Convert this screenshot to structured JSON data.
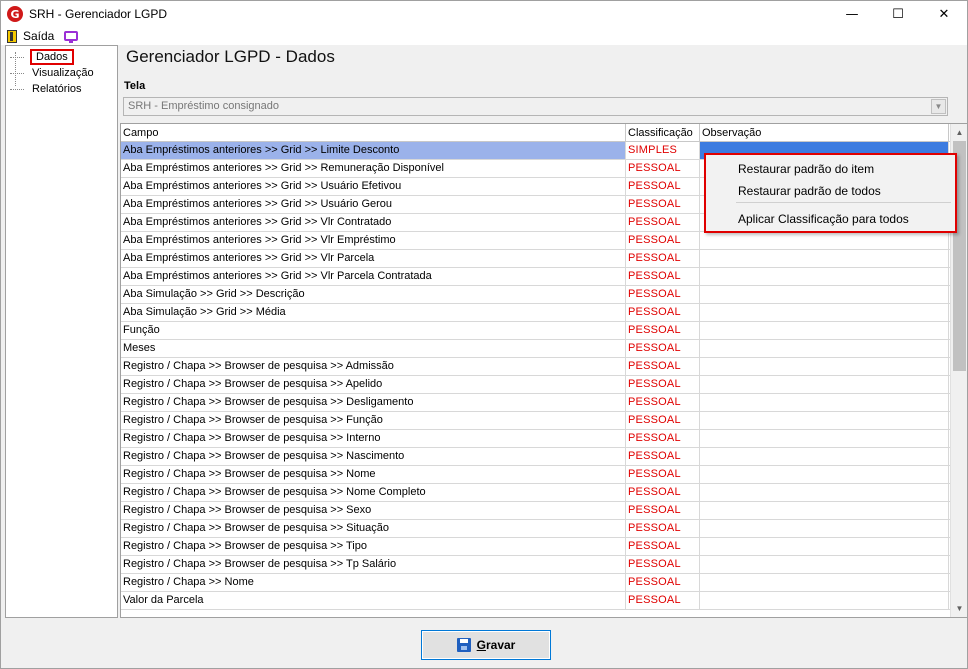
{
  "window": {
    "title": "SRH - Gerenciador LGPD",
    "app_icon_letter": "G",
    "controls": {
      "minimize": "—",
      "maximize": "☐",
      "close": "✕"
    }
  },
  "menubar": {
    "exit_label": "Saída"
  },
  "tree": {
    "items": [
      {
        "label": "Dados",
        "selected": true
      },
      {
        "label": "Visualização"
      },
      {
        "label": "Relatórios"
      }
    ]
  },
  "header": {
    "title": "Gerenciador LGPD - Dados"
  },
  "tela": {
    "label": "Tela",
    "value": "SRH - Empréstimo consignado"
  },
  "grid": {
    "columns": [
      "Campo",
      "Classificação",
      "Observação"
    ],
    "rows": [
      {
        "campo": "Aba Empréstimos anteriores >> Grid >> Limite Desconto",
        "classificacao": "SIMPLES",
        "observacao": ""
      },
      {
        "campo": "Aba Empréstimos anteriores >> Grid >> Remuneração Disponível",
        "classificacao": "PESSOAL",
        "observacao": ""
      },
      {
        "campo": "Aba Empréstimos anteriores >> Grid >> Usuário Efetivou",
        "classificacao": "PESSOAL",
        "observacao": ""
      },
      {
        "campo": "Aba Empréstimos anteriores >> Grid >> Usuário Gerou",
        "classificacao": "PESSOAL",
        "observacao": ""
      },
      {
        "campo": "Aba Empréstimos anteriores >> Grid >> Vlr Contratado",
        "classificacao": "PESSOAL",
        "observacao": ""
      },
      {
        "campo": "Aba Empréstimos anteriores >> Grid >> Vlr Empréstimo",
        "classificacao": "PESSOAL",
        "observacao": ""
      },
      {
        "campo": "Aba Empréstimos anteriores >> Grid >> Vlr Parcela",
        "classificacao": "PESSOAL",
        "observacao": ""
      },
      {
        "campo": "Aba Empréstimos anteriores >> Grid >> Vlr Parcela Contratada",
        "classificacao": "PESSOAL",
        "observacao": ""
      },
      {
        "campo": "Aba Simulação >> Grid >> Descrição",
        "classificacao": "PESSOAL",
        "observacao": ""
      },
      {
        "campo": "Aba Simulação >> Grid >> Média",
        "classificacao": "PESSOAL",
        "observacao": ""
      },
      {
        "campo": "Função",
        "classificacao": "PESSOAL",
        "observacao": ""
      },
      {
        "campo": "Meses",
        "classificacao": "PESSOAL",
        "observacao": ""
      },
      {
        "campo": "Registro / Chapa >> Browser de pesquisa >> Admissão",
        "classificacao": "PESSOAL",
        "observacao": ""
      },
      {
        "campo": "Registro / Chapa >> Browser de pesquisa >> Apelido",
        "classificacao": "PESSOAL",
        "observacao": ""
      },
      {
        "campo": "Registro / Chapa >> Browser de pesquisa >> Desligamento",
        "classificacao": "PESSOAL",
        "observacao": ""
      },
      {
        "campo": "Registro / Chapa >> Browser de pesquisa >> Função",
        "classificacao": "PESSOAL",
        "observacao": ""
      },
      {
        "campo": "Registro / Chapa >> Browser de pesquisa >> Interno",
        "classificacao": "PESSOAL",
        "observacao": ""
      },
      {
        "campo": "Registro / Chapa >> Browser de pesquisa >> Nascimento",
        "classificacao": "PESSOAL",
        "observacao": ""
      },
      {
        "campo": "Registro / Chapa >> Browser de pesquisa >> Nome",
        "classificacao": "PESSOAL",
        "observacao": ""
      },
      {
        "campo": "Registro / Chapa >> Browser de pesquisa >> Nome Completo",
        "classificacao": "PESSOAL",
        "observacao": ""
      },
      {
        "campo": "Registro / Chapa >> Browser de pesquisa >> Sexo",
        "classificacao": "PESSOAL",
        "observacao": ""
      },
      {
        "campo": "Registro / Chapa >> Browser de pesquisa >> Situação",
        "classificacao": "PESSOAL",
        "observacao": ""
      },
      {
        "campo": "Registro / Chapa >> Browser de pesquisa >> Tipo",
        "classificacao": "PESSOAL",
        "observacao": ""
      },
      {
        "campo": "Registro / Chapa >> Browser de pesquisa >> Tp Salário",
        "classificacao": "PESSOAL",
        "observacao": ""
      },
      {
        "campo": "Registro / Chapa >> Nome",
        "classificacao": "PESSOAL",
        "observacao": ""
      },
      {
        "campo": "Valor da Parcela",
        "classificacao": "PESSOAL",
        "observacao": ""
      }
    ]
  },
  "context_menu": {
    "items": [
      "Restaurar padrão do item",
      "Restaurar padrão de todos",
      "Aplicar Classificação para todos"
    ]
  },
  "footer": {
    "save_button_prefix": "G",
    "save_button_rest": "ravar"
  },
  "colors": {
    "classification_text": "#e00000",
    "selected_row": "#9bb2ea",
    "selected_cell": "#3c7be0",
    "highlight_outline": "#e00000"
  }
}
